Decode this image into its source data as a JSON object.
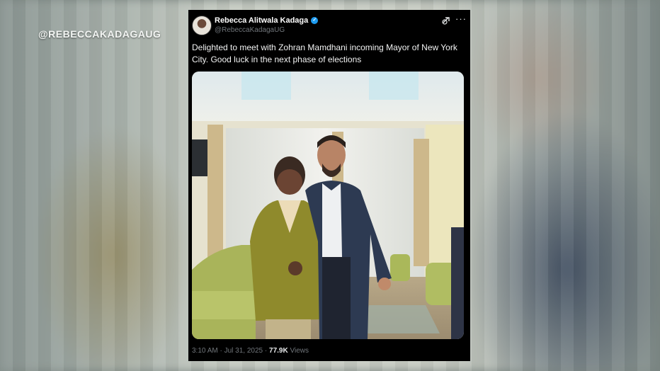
{
  "watermark": "@REBECCAKADAGAUG",
  "tweet": {
    "display_name": "Rebecca Alitwala Kadaga",
    "handle": "@RebeccaKadagaUG",
    "text": "Delighted to meet with Zohran Mamdhani incoming Mayor of New York City. Good luck in the next phase of elections",
    "time": "3:10 AM",
    "separator": "·",
    "date": "Jul 31, 2025",
    "views_count": "77.9K",
    "views_label": "Views"
  },
  "icons": {
    "verified": "verified-badge-icon",
    "grok": "grok-icon",
    "more": "more-options-icon"
  },
  "colors": {
    "card_bg": "#000000",
    "verified": "#1d9bf0",
    "muted_text": "#71767b"
  }
}
